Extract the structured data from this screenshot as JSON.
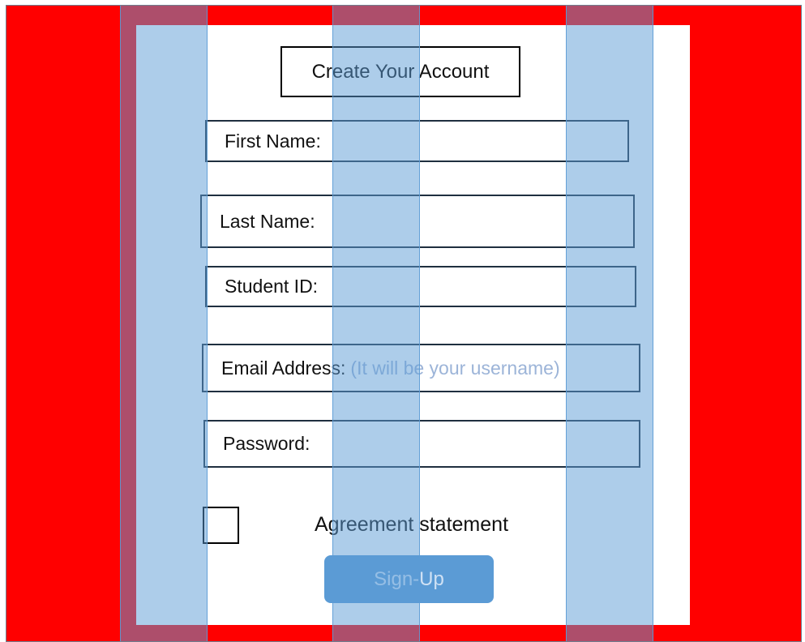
{
  "form": {
    "title": "Create Your Account",
    "fields": [
      {
        "label": "First Name:",
        "hint": ""
      },
      {
        "label": "Last Name:",
        "hint": ""
      },
      {
        "label": "Student ID:",
        "hint": ""
      },
      {
        "label": "Email Address:",
        "hint": "(It will be your username)"
      },
      {
        "label": "Password:",
        "hint": ""
      }
    ],
    "agreement_label": "Agreement statement",
    "submit_label": "Sign-Up"
  },
  "colors": {
    "background": "#ff0000",
    "card": "#ffffff",
    "guide_overlay": "#5b9bd5",
    "button": "#5b9bd5"
  }
}
